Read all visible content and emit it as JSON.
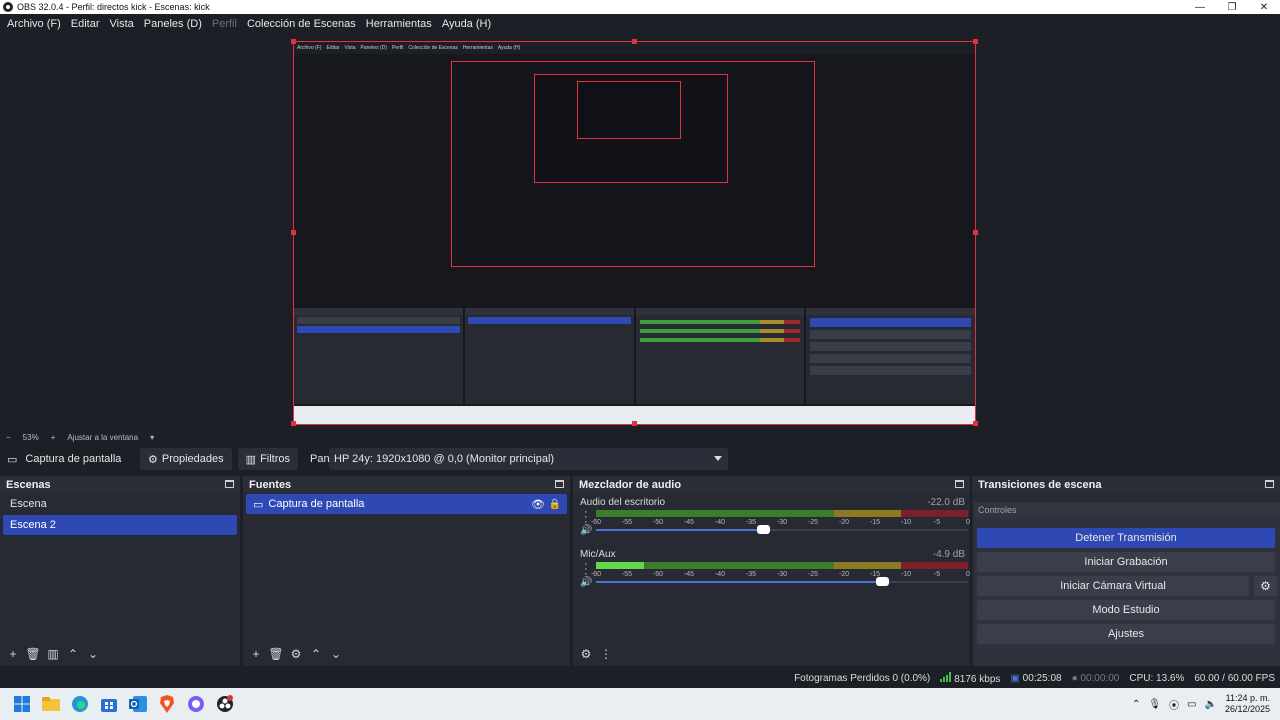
{
  "window": {
    "title": "OBS 32.0.4 - Perfil: directos kick - Escenas: kick"
  },
  "menu": [
    {
      "label": "Archivo (F)",
      "disabled": false
    },
    {
      "label": "Editar",
      "disabled": false
    },
    {
      "label": "Vista",
      "disabled": false
    },
    {
      "label": "Paneles (D)",
      "disabled": false
    },
    {
      "label": "Perfil",
      "disabled": true
    },
    {
      "label": "Colección de Escenas",
      "disabled": false
    },
    {
      "label": "Herramientas",
      "disabled": false
    },
    {
      "label": "Ayuda (H)",
      "disabled": false
    }
  ],
  "zoom": {
    "minus": "−",
    "value": "53%",
    "plus": "+",
    "fit_label": "Ajustar a la ventana"
  },
  "source_bar": {
    "source_name": "Captura de pantalla",
    "properties_label": "Propiedades",
    "filters_label": "Filtros",
    "display_label": "Pantalla",
    "display_value": "HP 24y: 1920x1080 @ 0,0 (Monitor principal)"
  },
  "scenes": {
    "title": "Escenas",
    "items": [
      "Escena",
      "Escena 2"
    ],
    "selected": 1
  },
  "sources": {
    "title": "Fuentes",
    "items": [
      {
        "label": "Captura de pantalla"
      }
    ]
  },
  "mixer": {
    "title": "Mezclador de audio",
    "ticks": [
      "-60",
      "-55",
      "-50",
      "-45",
      "-40",
      "-35",
      "-30",
      "-25",
      "-20",
      "-15",
      "-10",
      "-5",
      "0"
    ],
    "channels": [
      {
        "name": "Audio del escritorio",
        "db": "-22.0 dB",
        "level": 0.0,
        "volume": 0.45
      },
      {
        "name": "Mic/Aux",
        "db": "-4.9 dB",
        "level": 0.13,
        "volume": 0.77
      }
    ]
  },
  "transitions": {
    "title": "Transiciones de escena",
    "controls_title": "Controles",
    "buttons": {
      "stop_stream": "Detener Transmisión",
      "start_recording": "Iniciar Grabación",
      "start_virtual_cam": "Iniciar Cámara Virtual",
      "studio_mode": "Modo Estudio",
      "settings": "Ajustes"
    }
  },
  "status": {
    "dropped_frames": "Fotogramas Perdidos 0 (0.0%)",
    "bitrate": "8176 kbps",
    "stream_time": "00:25:08",
    "record_time": "00:00:00",
    "cpu": "CPU: 13.6%",
    "fps": "60.00 / 60.00 FPS"
  },
  "taskbar": {
    "time": "11:24 p. m.",
    "date": "26/12/2025"
  },
  "colors": {
    "accent": "#2f49b4",
    "selection_border": "#e0313f",
    "meter_green": "#62d94b"
  }
}
